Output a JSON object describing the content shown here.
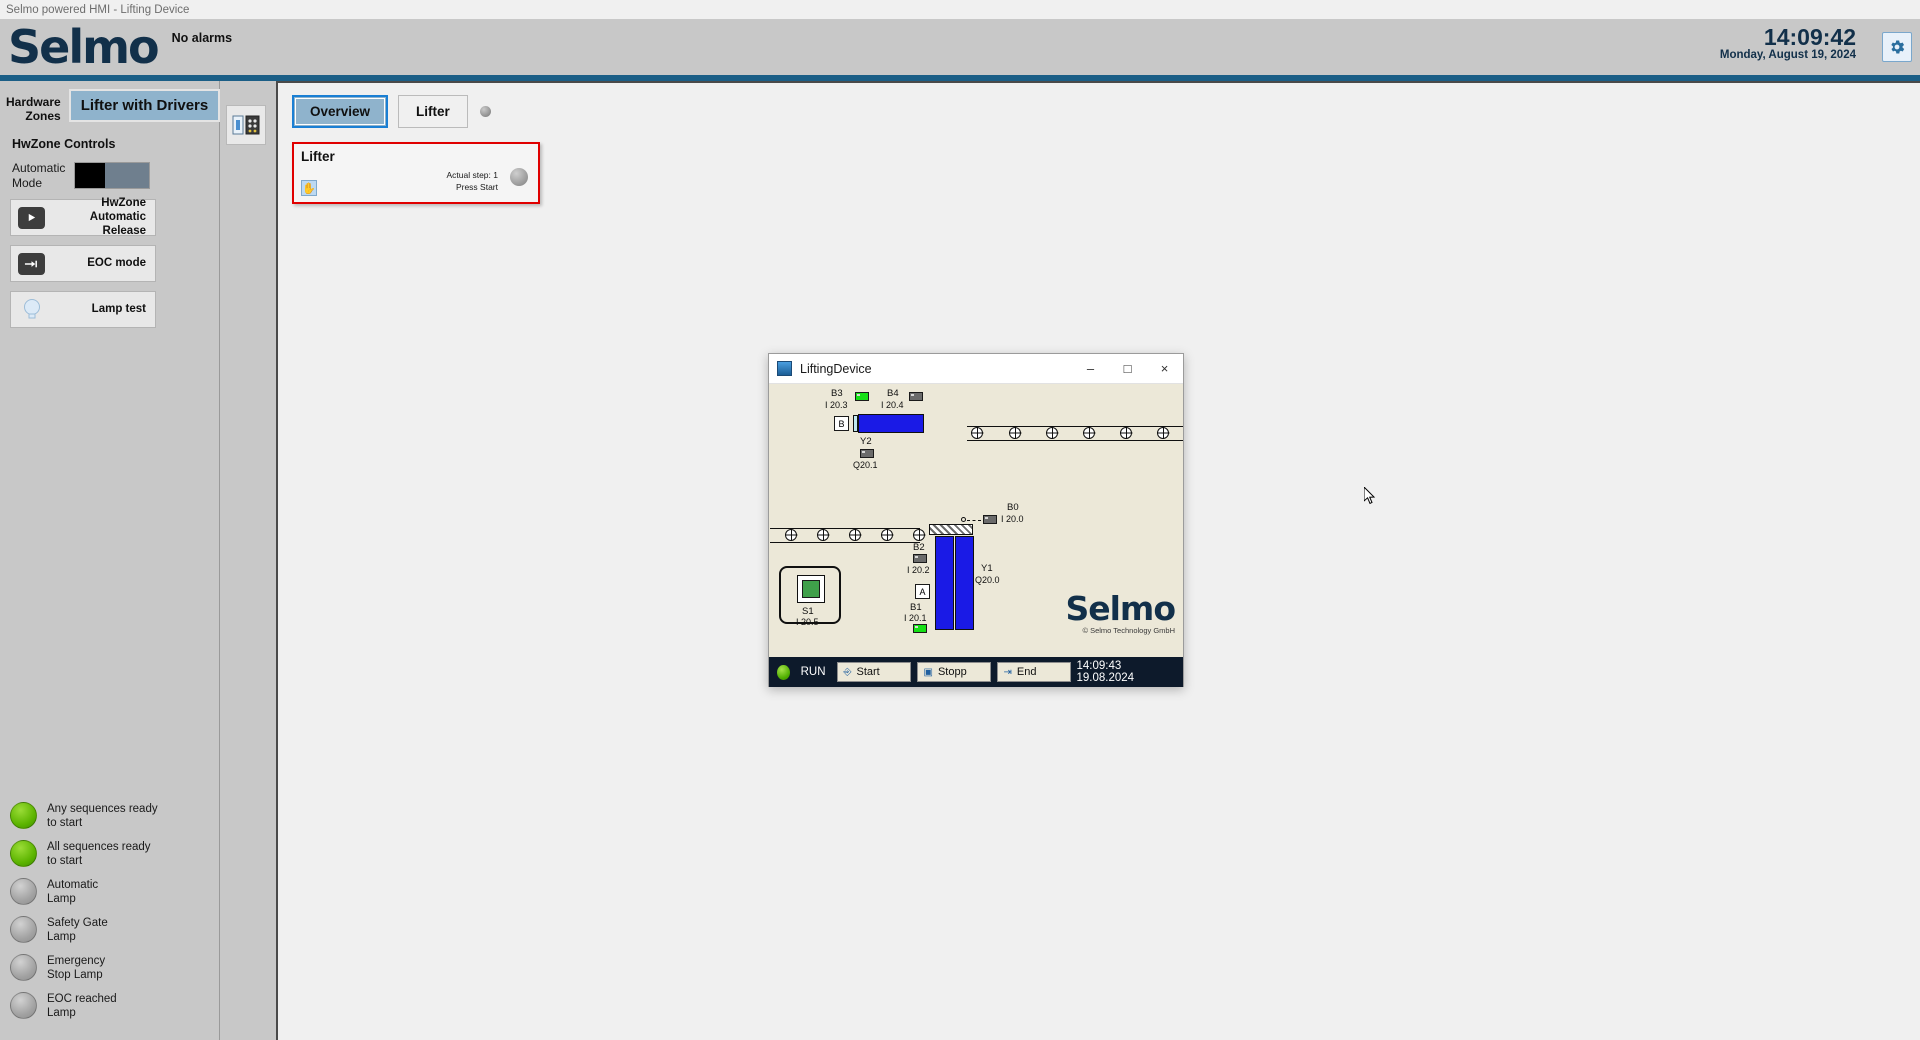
{
  "os": {
    "window_title": "Selmo powered HMI - Lifting Device"
  },
  "header": {
    "brand": "Selmo",
    "alarm_status": "No alarms",
    "time": "14:09:42",
    "date": "Monday, August 19, 2024",
    "settings_icon": "gear-icon",
    "accent_color": "#1b5e86"
  },
  "sidebar": {
    "zone_label": "Hardware\nZones",
    "zone_label_line1": "Hardware",
    "zone_label_line2": "Zones",
    "active_zone": "Lifter with Drivers",
    "controls_title": "HwZone Controls",
    "automatic_mode_label_line1": "Automatic",
    "automatic_mode_label_line2": "Mode",
    "buttons": [
      {
        "icon": "play-icon",
        "line1": "HwZone",
        "line2": "Automatic Release"
      },
      {
        "icon": "end-of-cycle-icon",
        "line1": "",
        "line2": "EOC mode"
      },
      {
        "icon": "lamp-icon",
        "line1": "",
        "line2": "Lamp test"
      }
    ],
    "lamps": [
      {
        "state": "on",
        "line1": "Any sequences ready",
        "line2": "to start"
      },
      {
        "state": "on",
        "line1": "All sequences ready",
        "line2": "to start"
      },
      {
        "state": "off",
        "line1": "Automatic",
        "line2": "Lamp"
      },
      {
        "state": "off",
        "line1": "Safety Gate",
        "line2": "Lamp"
      },
      {
        "state": "off",
        "line1": "Emergency",
        "line2": "Stop Lamp"
      },
      {
        "state": "off",
        "line1": "EOC reached",
        "line2": "Lamp"
      }
    ]
  },
  "main": {
    "tabs": [
      {
        "label": "Overview",
        "active": true
      },
      {
        "label": "Lifter",
        "active": false
      }
    ],
    "device_card": {
      "title": "Lifter",
      "step_line1": "Actual step: 1",
      "step_line2": "Press Start",
      "hand_icon": "hand-icon"
    }
  },
  "sim_window": {
    "title": "LiftingDevice",
    "app_icon": "filmstrip-icon",
    "minimize": "–",
    "maximize": "□",
    "close": "×",
    "brand": "Selmo",
    "copyright": "© Selmo Technology GmbH",
    "statusbar": {
      "run_label": "RUN",
      "buttons": [
        {
          "label": "Start",
          "icon": "start-icon"
        },
        {
          "label": "Stopp",
          "icon": "stop-icon"
        },
        {
          "label": "End",
          "icon": "end-icon"
        }
      ],
      "time": "14:09:43",
      "date": "19.08.2024"
    },
    "io_points": [
      {
        "name": "B3",
        "address": "I 20.3",
        "state": "active"
      },
      {
        "name": "B4",
        "address": "I 20.4",
        "state": "inactive"
      },
      {
        "name": "Y2",
        "address": "Q20.1",
        "state": "inactive"
      },
      {
        "name": "B0",
        "address": "I 20.0",
        "state": "inactive"
      },
      {
        "name": "B2",
        "address": "I 20.2",
        "state": "inactive"
      },
      {
        "name": "B1",
        "address": "I 20.1",
        "state": "active"
      },
      {
        "name": "Y1",
        "address": "Q20.0",
        "state": "inactive"
      },
      {
        "name": "S1",
        "address": "I 20.5",
        "state": "active"
      }
    ],
    "markers": [
      {
        "label": "B"
      },
      {
        "label": "A"
      }
    ]
  }
}
